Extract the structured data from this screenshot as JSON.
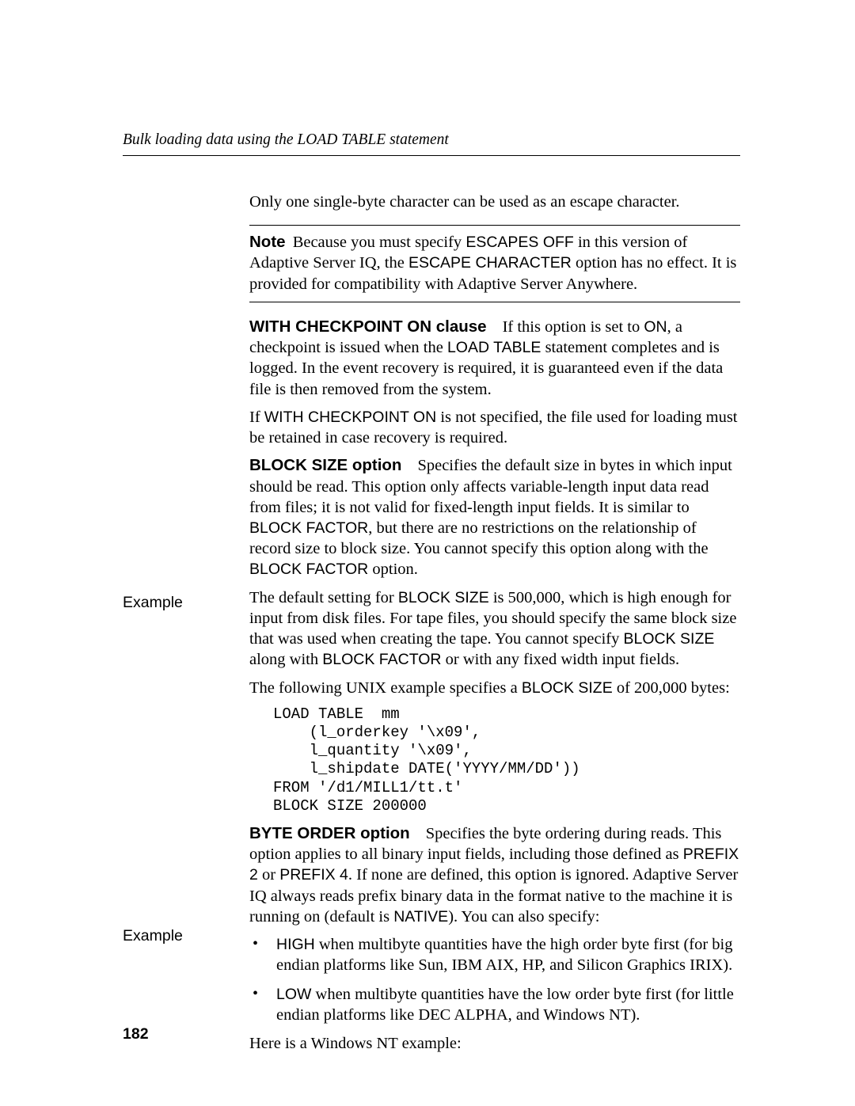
{
  "header": {
    "running_title": "Bulk loading data using the LOAD TABLE statement"
  },
  "page_number": "182",
  "side_labels": {
    "example1": "Example",
    "example2": "Example"
  },
  "body": {
    "escape_line": "Only one single-byte character can be used as an escape character.",
    "note": {
      "label": "Note",
      "text_before": "Because you must specify ",
      "escapes_off": "ESCAPES OFF",
      "text_mid": " in this version of Adaptive Server IQ, the ",
      "escape_char": "ESCAPE CHARACTER",
      "text_after": " option has no effect. It is provided for compatibility with Adaptive Server Anywhere."
    },
    "with_checkpoint": {
      "runin": "WITH CHECKPOINT ON clause",
      "p1a": "If this option is set to ",
      "on": "ON",
      "p1b": ", a checkpoint is issued when the ",
      "load_table": "LOAD TABLE",
      "p1c": " statement completes and is logged. In the event recovery is required, it is guaranteed even if the data file is then removed from the system.",
      "p2a": "If ",
      "with_cp_on": "WITH CHECKPOINT ON",
      "p2b": " is not specified, the file used for loading must be retained in case recovery is required."
    },
    "block_size": {
      "runin": "BLOCK SIZE option",
      "p1a": "Specifies the default size in bytes in which input should be read. This option only affects variable-length input data read from files; it is not valid for fixed-length input fields. It is similar to ",
      "block_factor1": "BLOCK FACTOR",
      "p1b": ", but there are no restrictions on the relationship of record size to block size. You cannot specify this option along with the ",
      "block_factor2": "BLOCK FACTOR",
      "p1c": " option.",
      "p2a": "The default setting for ",
      "block_size1": "BLOCK SIZE",
      "p2b": " is 500,000, which is high enough for input from disk files. For tape files, you should specify the same block size that was used when creating the tape. You cannot specify ",
      "block_size2": "BLOCK SIZE",
      "p2c": " along with ",
      "block_factor3": "BLOCK FACTOR",
      "p2d": " or with any fixed width input fields."
    },
    "example1_intro_a": "The following UNIX example specifies a ",
    "example1_bs": "BLOCK SIZE",
    "example1_intro_b": " of 200,000 bytes:",
    "code1": "LOAD TABLE  mm\n    (l_orderkey '\\x09',\n    l_quantity '\\x09',\n    l_shipdate DATE('YYYY/MM/DD'))\nFROM '/d1/MILL1/tt.t'\nBLOCK SIZE 200000",
    "byte_order": {
      "runin": "BYTE ORDER option",
      "p1a": "Specifies the byte ordering during reads. This option applies to all binary input fields, including those defined as ",
      "prefix2": "PREFIX 2",
      "p1b": " or ",
      "prefix4": "PREFIX 4",
      "p1c": ". If none are defined, this option is ignored. Adaptive Server IQ always reads prefix binary data in the format native to the machine it is running on (default is ",
      "native": "NATIVE",
      "p1d": "). You can also specify:"
    },
    "bullets": {
      "b1a": "HIGH",
      "b1b": " when multibyte quantities have the high order byte first (for big endian platforms like Sun, IBM AIX, HP, and Silicon Graphics IRIX).",
      "b2a": "LOW",
      "b2b": " when multibyte quantities have the low order byte first (for little endian platforms like DEC ALPHA, and Windows NT)."
    },
    "example2_intro": "Here is a Windows NT example:"
  }
}
